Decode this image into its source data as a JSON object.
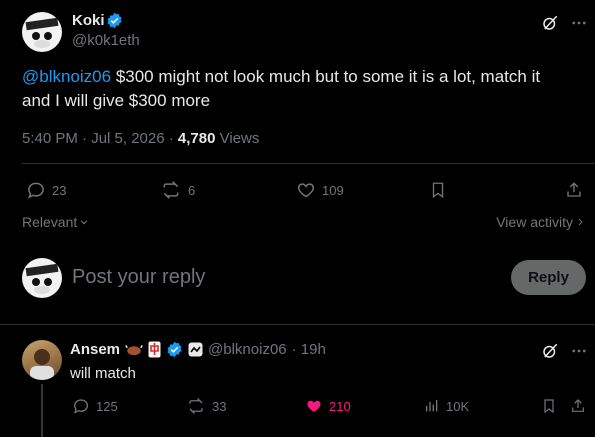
{
  "tweet": {
    "author_name": "Koki",
    "author_handle": "@k0k1eth",
    "mention": "@blknoiz06",
    "text_line1": " $300 might not look much but to some it is a lot, match it",
    "text_line2": "and I will give $300 more",
    "time": "5:40 PM · Jul 5, 2026 · ",
    "views_count": "4,780",
    "views_label": " Views",
    "replies": "23",
    "reposts": "6",
    "likes": "109",
    "relevant_label": "Relevant",
    "view_activity_label": "View activity"
  },
  "compose": {
    "placeholder": "Post your reply",
    "reply_button": "Reply"
  },
  "reply": {
    "author_name": "Ansem",
    "author_handle": "@blknoiz06",
    "time": "· 19h",
    "text": "will match",
    "replies": "125",
    "reposts": "33",
    "likes": "210",
    "views": "10K"
  },
  "colors": {
    "accent": "#1d9bf0",
    "like_active": "#f91880",
    "muted": "#71767b"
  },
  "icons": [
    "verified-badge-icon",
    "grok-icon",
    "more-icon",
    "reply-icon",
    "repost-icon",
    "like-icon",
    "bookmark-icon",
    "share-icon",
    "views-icon",
    "chevron-down-icon",
    "chevron-right-icon"
  ]
}
